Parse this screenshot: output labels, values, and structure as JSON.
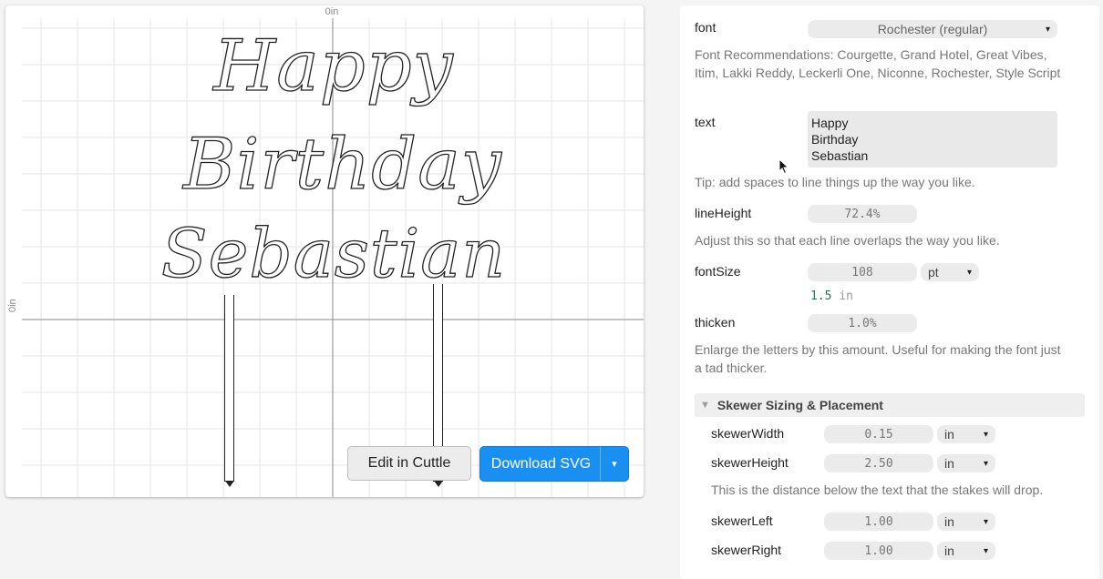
{
  "canvas": {
    "ruler_top_label": "0in",
    "ruler_left_label": "0in",
    "text_lines": [
      "Happy",
      "Birthday",
      "Sebastian"
    ],
    "edit_button": "Edit in Cuttle",
    "download_button": "Download SVG",
    "download_caret": "▾"
  },
  "settings": {
    "font": {
      "label": "font",
      "value": "Rochester (regular)",
      "help": "Font Recommendations: Courgette, Grand Hotel, Great Vibes, Itim, Lakki Reddy, Leckerli One, Niconne, Rochester, Style Script"
    },
    "text": {
      "label": "text",
      "lines": [
        "Happy",
        "Birthday",
        "Sebastian"
      ],
      "help": "Tip: add spaces to line things up the way you like."
    },
    "lineHeight": {
      "label": "lineHeight",
      "value": "72.4%",
      "help": "Adjust this so that each line overlaps the way you like."
    },
    "fontSize": {
      "label": "fontSize",
      "value": "108",
      "unit": "pt",
      "converted_value": "1.5",
      "converted_unit": "in"
    },
    "thicken": {
      "label": "thicken",
      "value": "1.0%",
      "help": "Enlarge the letters by this amount. Useful for making the font just a tad thicker."
    },
    "skewer_section": {
      "title": "Skewer Sizing & Placement",
      "skewerWidth": {
        "label": "skewerWidth",
        "value": "0.15",
        "unit": "in"
      },
      "skewerHeight": {
        "label": "skewerHeight",
        "value": "2.50",
        "unit": "in"
      },
      "skewerHeight_help": "This is the distance below the text that the stakes will drop.",
      "skewerLeft": {
        "label": "skewerLeft",
        "value": "1.00",
        "unit": "in"
      },
      "skewerRight": {
        "label": "skewerRight",
        "value": "1.00",
        "unit": "in"
      }
    }
  },
  "colors": {
    "accent": "#1a8ff2",
    "converted_value": "#1a7a55"
  }
}
